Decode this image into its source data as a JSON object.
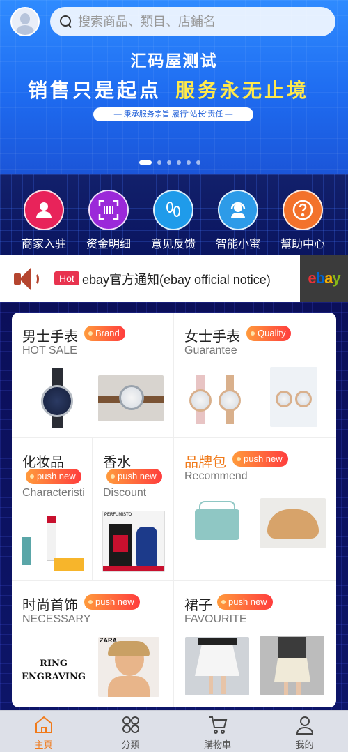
{
  "header": {
    "search_placeholder": "搜索商品、類目、店鋪名"
  },
  "banner": {
    "title": "汇码屋测试",
    "slogan_white": "销售只是起点",
    "slogan_yellow": "服务永无止境",
    "subtitle": "— 秉承服务宗旨 履行“站长”责任 —",
    "slides": 6,
    "active_slide": 1
  },
  "quick_menu": [
    {
      "label": "商家入驻",
      "icon": "merchant-person-icon",
      "color": "#e8235a"
    },
    {
      "label": "资金明细",
      "icon": "barcode-scan-icon",
      "color": "#9b29d9"
    },
    {
      "label": "意见反馈",
      "icon": "footprints-icon",
      "color": "#1f9bea"
    },
    {
      "label": "智能小蜜",
      "icon": "customer-service-headset-icon",
      "color": "#2d9be8"
    },
    {
      "label": "幫助中心",
      "icon": "help-question-icon",
      "color": "#f3722c"
    }
  ],
  "notice": {
    "badge": "Hot",
    "text": "ebay官方通知(ebay official notice)",
    "logo": "ebay"
  },
  "categories": [
    {
      "title": "男士手表",
      "badge": "Brand",
      "subtitle": "HOT SALE"
    },
    {
      "title": "女士手表",
      "badge": "Quality",
      "subtitle": "Guarantee"
    },
    {
      "title": "化妆品",
      "badge": "push new",
      "subtitle": "Characteristi"
    },
    {
      "title": "香水",
      "badge": "push new",
      "subtitle": "Discount"
    },
    {
      "title": "品牌包",
      "badge": "push new",
      "subtitle": "Recommend"
    },
    {
      "title": "时尚首饰",
      "badge": "push new",
      "subtitle": "NECESSARY"
    },
    {
      "title": "裙子",
      "badge": "push new",
      "subtitle": "FAVOURITE"
    }
  ],
  "product_text": {
    "ring": "RING\nENGRAVING",
    "zara": "ZARA",
    "perfume_brand": "PERFUMISTO"
  },
  "colors": {
    "accent": "#f07a1a",
    "badge_start": "#ff9a3c",
    "badge_end": "#ff3d3d"
  },
  "tabbar": [
    {
      "label": "主頁",
      "icon": "home-icon",
      "active": true
    },
    {
      "label": "分類",
      "icon": "category-grid-icon",
      "active": false
    },
    {
      "label": "購物車",
      "icon": "cart-icon",
      "active": false
    },
    {
      "label": "我的",
      "icon": "profile-icon",
      "active": false
    }
  ]
}
